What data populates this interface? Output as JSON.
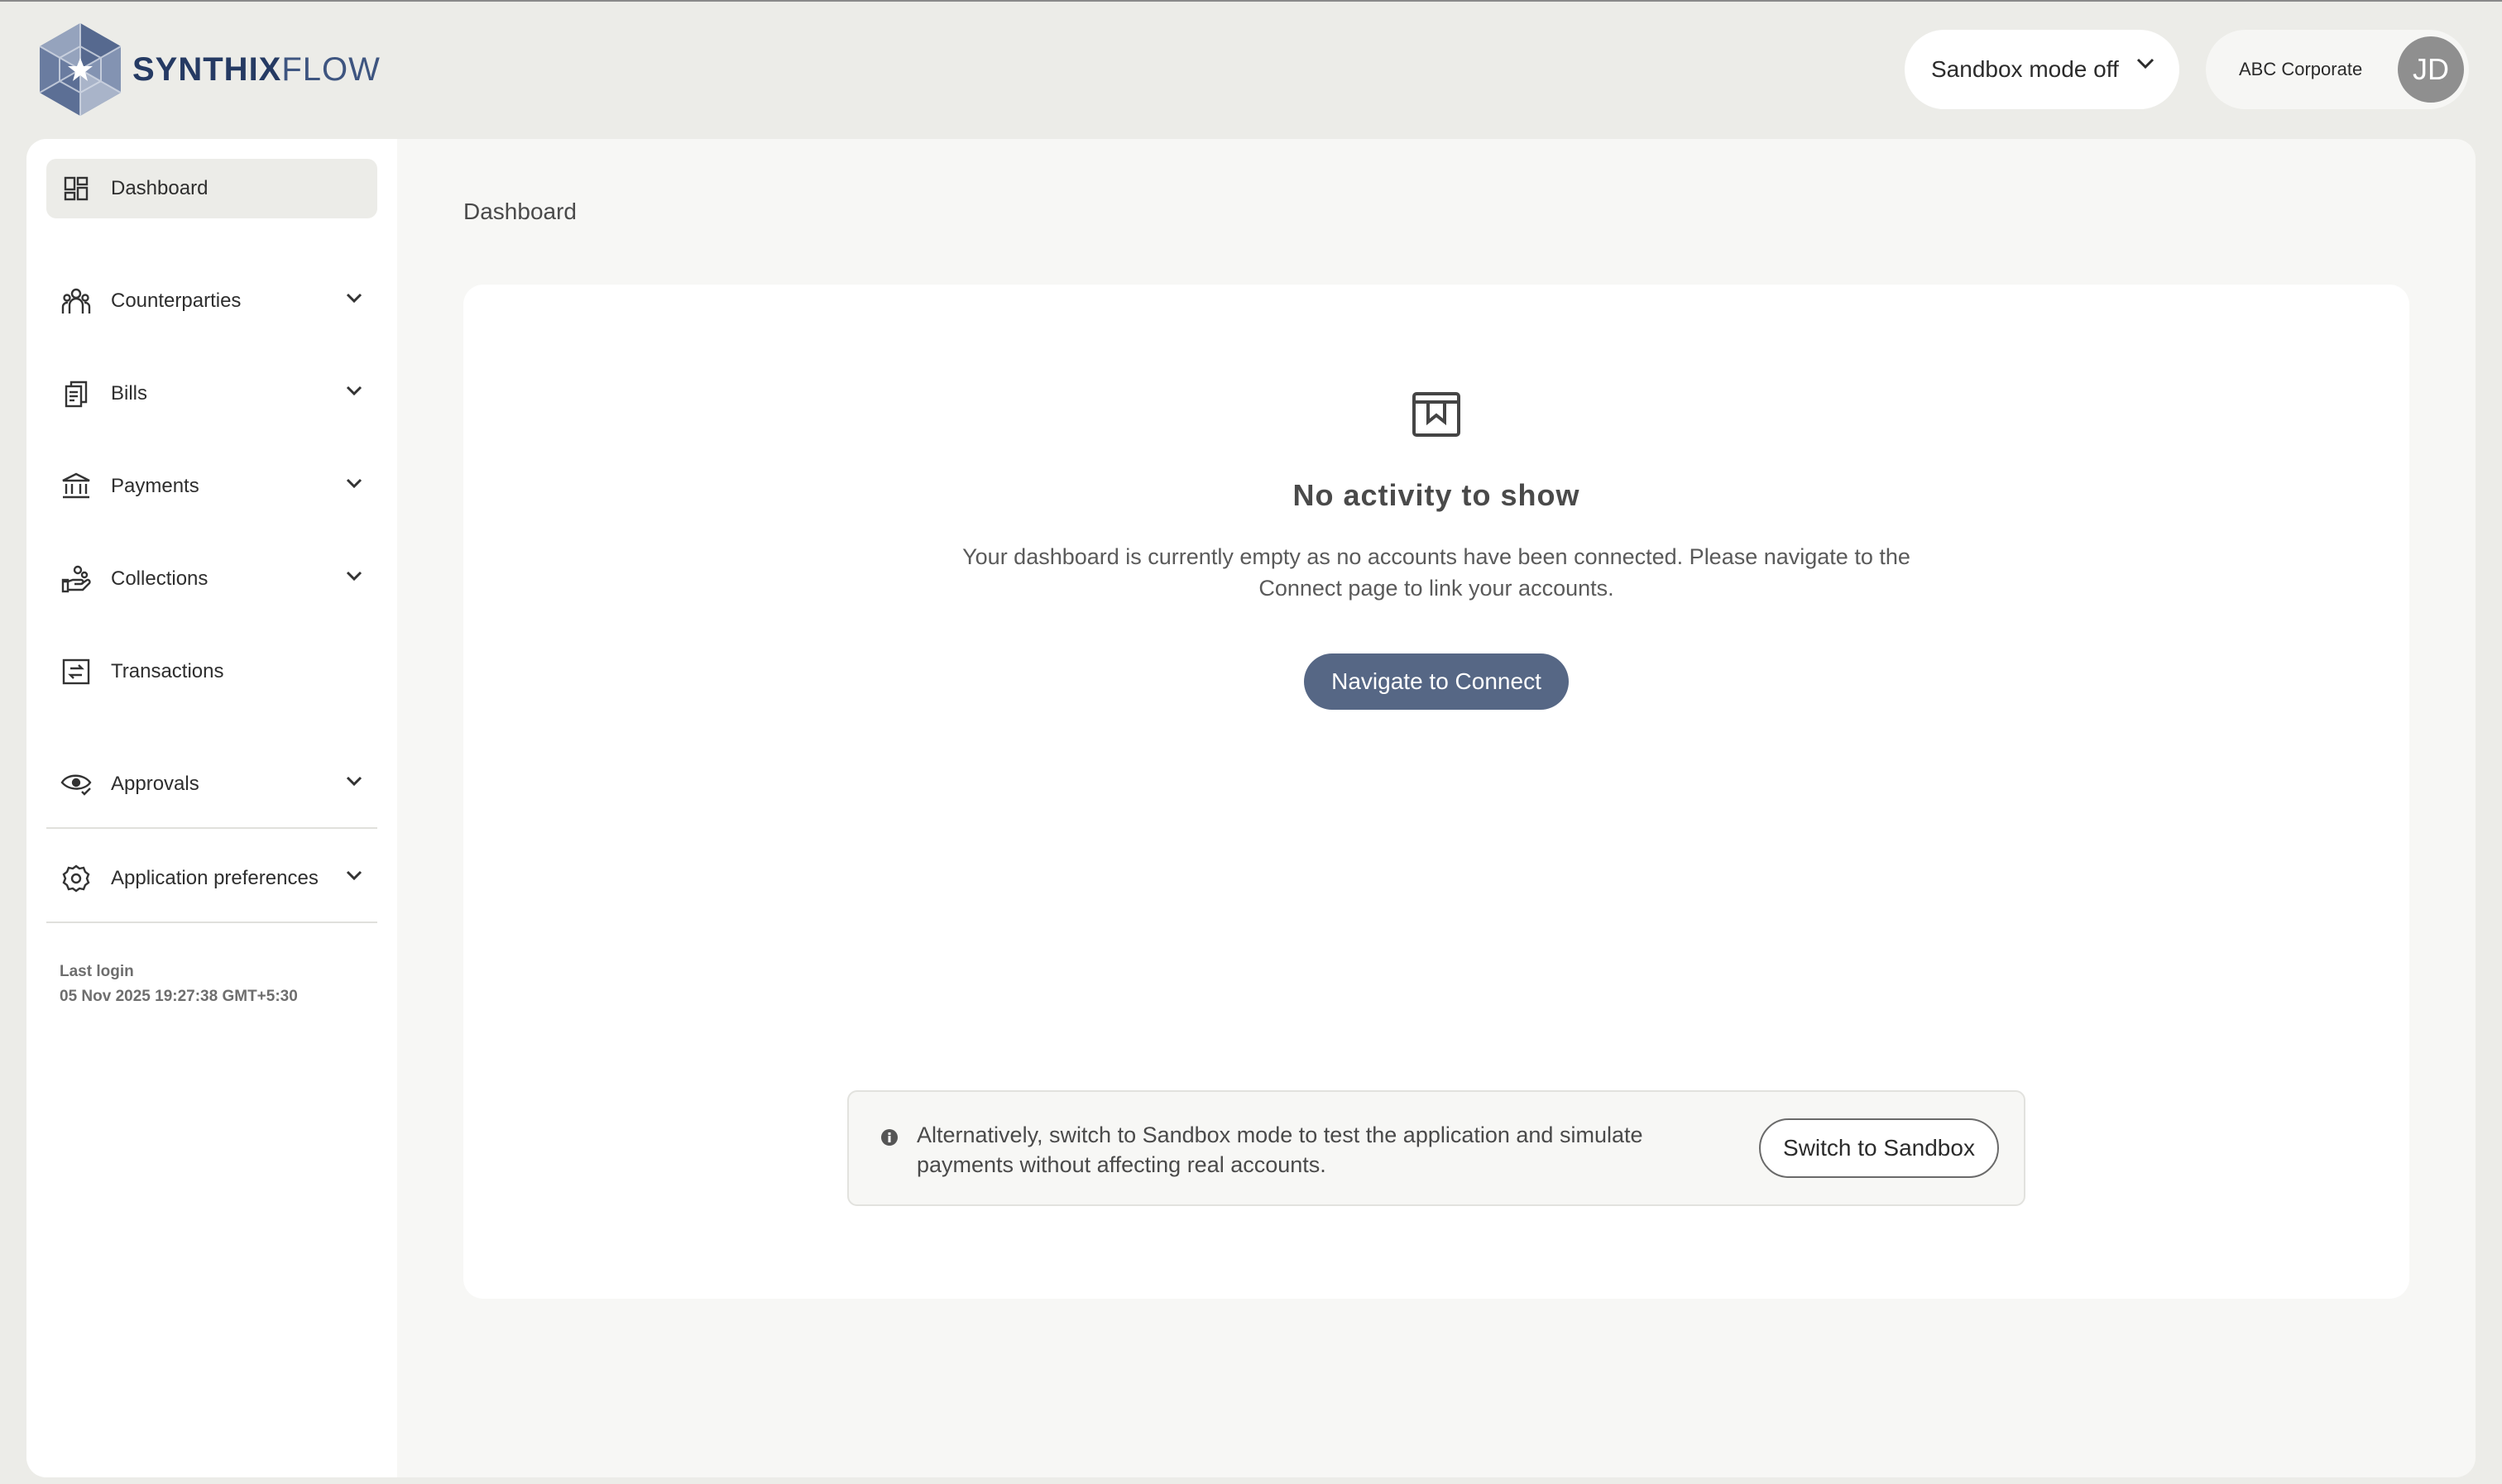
{
  "brand": {
    "name_bold": "SYNTHIX",
    "name_light": "FLOW",
    "primary_color": "#253a63",
    "button_color": "#566785"
  },
  "header": {
    "sandbox_select": {
      "label": "Sandbox mode off"
    },
    "user": {
      "organization": "ABC Corporate",
      "initials": "JD"
    }
  },
  "sidebar": {
    "items": [
      {
        "label": "Dashboard",
        "icon": "dashboard-icon",
        "active": true
      },
      {
        "label": "Counterparties",
        "icon": "people-icon",
        "expandable": true
      },
      {
        "label": "Bills",
        "icon": "bills-icon",
        "expandable": true
      },
      {
        "label": "Payments",
        "icon": "bank-icon",
        "expandable": true
      },
      {
        "label": "Collections",
        "icon": "collections-icon",
        "expandable": true
      },
      {
        "label": "Transactions",
        "icon": "transactions-icon"
      },
      {
        "label": "Approvals",
        "icon": "eye-check-icon",
        "expandable": true
      },
      {
        "label": "Application preferences",
        "icon": "gear-icon",
        "expandable": true
      }
    ],
    "last_login": {
      "label": "Last login",
      "value": "05 Nov 2025 19:27:38 GMT+5:30"
    }
  },
  "main": {
    "page_title": "Dashboard",
    "empty_state": {
      "icon": "archive-box-icon",
      "title": "No activity to show",
      "description": "Your dashboard is currently empty as no accounts have been connected. Please navigate to the Connect page to link your accounts.",
      "button_label": "Navigate to Connect"
    },
    "sandbox_notice": {
      "icon": "info-icon",
      "text": "Alternatively, switch to Sandbox mode to test the application and simulate payments without affecting real accounts.",
      "button_label": "Switch to Sandbox"
    }
  }
}
